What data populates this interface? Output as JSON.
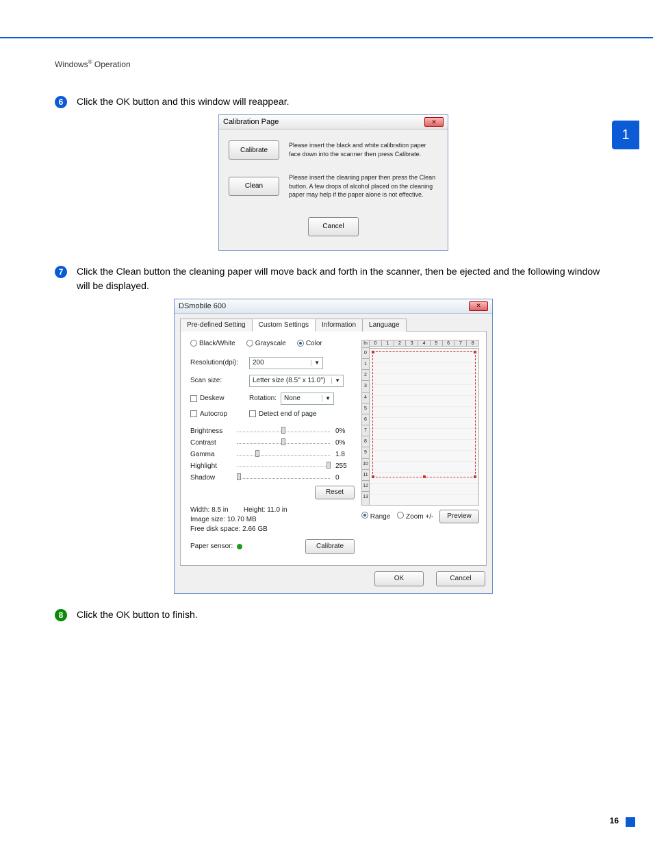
{
  "page": {
    "header": "Windows® Operation",
    "page_number": "16",
    "side_tab": "1"
  },
  "steps": {
    "s6": "Click the OK button and this window will reappear.",
    "s7": "Click the Clean button the cleaning paper will move back and forth in the scanner, then be ejected and the following window will be displayed.",
    "s8": "Click the OK button to finish."
  },
  "calib_dialog": {
    "title": "Calibration Page",
    "calibrate_btn": "Calibrate",
    "calibrate_desc": "Please insert the black and white calibration paper face down into the scanner then press Calibrate.",
    "clean_btn": "Clean",
    "clean_desc": "Please insert the cleaning paper then press the Clean button. A few drops of alcohol placed on the cleaning paper may help if the paper alone is not effective.",
    "cancel": "Cancel"
  },
  "scan_dialog": {
    "title": "DSmobile 600",
    "tabs": {
      "predef": "Pre-defined Setting",
      "custom": "Custom Settings",
      "info": "Information",
      "lang": "Language"
    },
    "color_mode": {
      "bw": "Black/White",
      "gray": "Grayscale",
      "color": "Color"
    },
    "fields": {
      "resolution_lbl": "Resolution(dpi):",
      "resolution_val": "200",
      "scansize_lbl": "Scan size:",
      "scansize_val": "Letter size (8.5'' x 11.0'')",
      "deskew": "Deskew",
      "rotation_lbl": "Rotation:",
      "rotation_val": "None",
      "autocrop": "Autocrop",
      "detect_end": "Detect end of page"
    },
    "sliders": {
      "brightness_lbl": "Brightness",
      "brightness_val": "0%",
      "contrast_lbl": "Contrast",
      "contrast_val": "0%",
      "gamma_lbl": "Gamma",
      "gamma_val": "1.8",
      "highlight_lbl": "Highlight",
      "highlight_val": "255",
      "shadow_lbl": "Shadow",
      "shadow_val": "0"
    },
    "reset": "Reset",
    "info_lines": {
      "width": "Width: 8.5 in",
      "height": "Height: 11.0 in",
      "imgsize": "Image size: 10.70 MB",
      "diskspace": "Free disk space: 2.66 GB"
    },
    "paper_sensor": "Paper sensor:",
    "calibrate_btn": "Calibrate",
    "preview": {
      "unit": "In",
      "range": "Range",
      "zoom": "Zoom +/-",
      "preview_btn": "Preview"
    },
    "ok": "OK",
    "cancel": "Cancel"
  }
}
